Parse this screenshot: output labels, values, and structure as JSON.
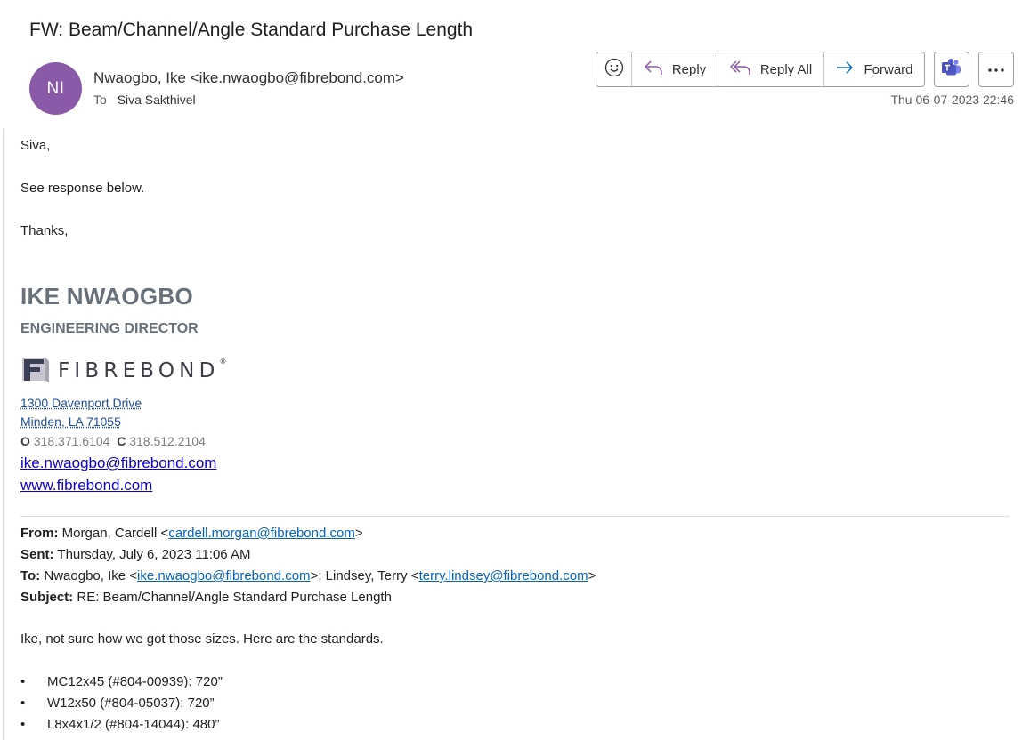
{
  "email": {
    "subject": "FW: Beam/Channel/Angle Standard Purchase Length",
    "avatar_initials": "NI",
    "sender": "Nwaogbo, Ike <ike.nwaogbo@fibrebond.com>",
    "to_label": "To",
    "to_name": "Siva Sakthivel",
    "date": "Thu 06-07-2023 22:46"
  },
  "toolbar": {
    "reply": "Reply",
    "reply_all": "Reply All",
    "forward": "Forward"
  },
  "body": {
    "greeting": "Siva,",
    "line1": "See response below.",
    "thanks": "Thanks,"
  },
  "signature": {
    "name": "IKE NWAOGBO",
    "title": "ENGINEERING DIRECTOR",
    "logo_text": "FIBREBOND",
    "logo_reg": "®",
    "address1": "1300 Davenport Drive",
    "address2": "Minden, LA 71055",
    "office_label": "O",
    "office_phone": "318.371.6104",
    "cell_label": "C",
    "cell_phone": "318.512.2104",
    "email": "ike.nwaogbo@fibrebond.com",
    "website": "www.fibrebond.com"
  },
  "forwarded": {
    "from_label": "From:",
    "from_name": "Morgan, Cardell <",
    "from_email": "cardell.morgan@fibrebond.com",
    "from_end": ">",
    "sent_label": "Sent:",
    "sent_value": "Thursday, July 6, 2023 11:06 AM",
    "to_label": "To:",
    "to_name1": "Nwaogbo, Ike <",
    "to_email1": "ike.nwaogbo@fibrebond.com",
    "to_mid": ">; Lindsey, Terry <",
    "to_email2": "terry.lindsey@fibrebond.com",
    "to_end": ">",
    "subject_label": "Subject:",
    "subject_value": "RE: Beam/Channel/Angle Standard Purchase Length",
    "message": "Ike, not sure how we got those sizes.  Here are the standards.",
    "bullet_char": "•",
    "items": [
      "MC12x45 (#804-00939): 720”",
      "W12x50 (#804-05037): 720”",
      "L8x4x1/2 (#804-14044):  480”"
    ]
  },
  "colors": {
    "avatar_bg": "#8a5aa8",
    "link": "#0563c1",
    "signature_gray": "#68707a",
    "reply_all_icon": "#8a5aa8",
    "forward_icon": "#0f6cbd"
  },
  "icons": [
    "emoji-icon",
    "reply-icon",
    "reply-all-icon",
    "forward-icon",
    "teams-icon",
    "more-icon"
  ]
}
